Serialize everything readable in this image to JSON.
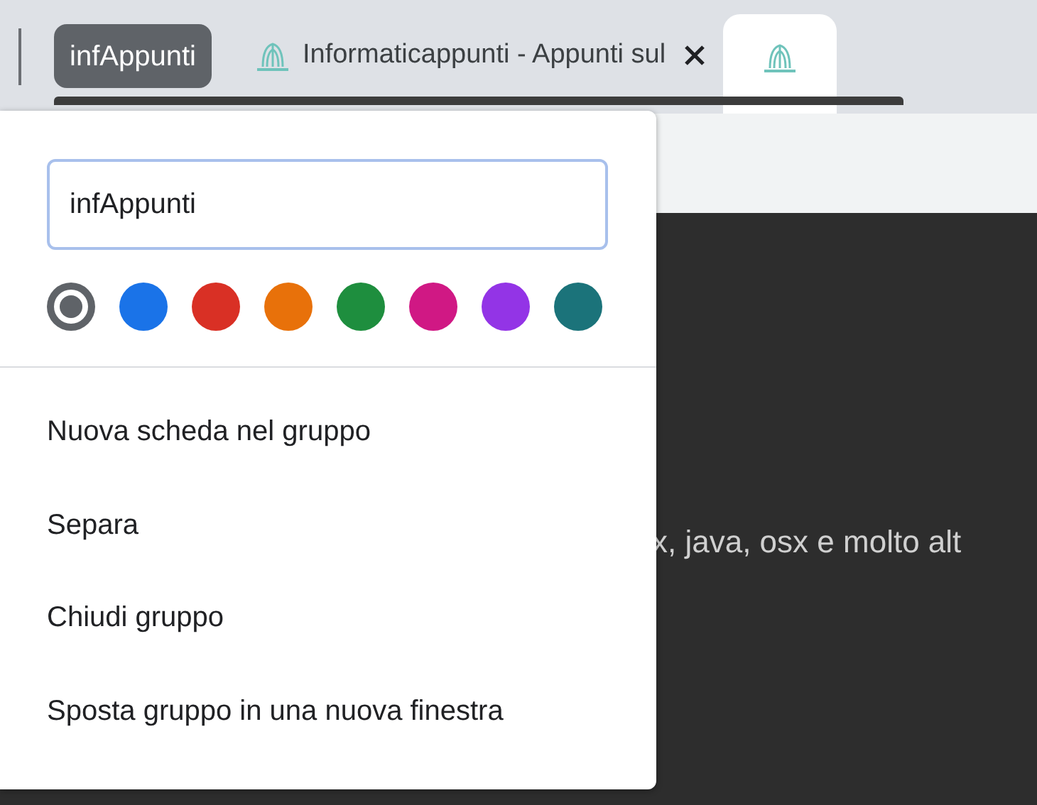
{
  "tab_group": {
    "label": "infAppunti",
    "color": "#5f6368"
  },
  "tabs": [
    {
      "title": "Informaticappunti - Appunti sul",
      "selected": false
    },
    {
      "selected": true
    }
  ],
  "page_text": "x, java, osx e molto alt",
  "group_editor": {
    "name_value": "infAppunti",
    "colors": [
      {
        "color": "#5f6368",
        "selected": true
      },
      {
        "color": "#1a73e8",
        "selected": false
      },
      {
        "color": "#d93025",
        "selected": false
      },
      {
        "color": "#e8710a",
        "selected": false
      },
      {
        "color": "#1e8e3e",
        "selected": false
      },
      {
        "color": "#d01884",
        "selected": false
      },
      {
        "color": "#9334e6",
        "selected": false
      },
      {
        "color": "#1b737a",
        "selected": false
      }
    ],
    "menu": [
      "Nuova scheda nel gruppo",
      "Separa",
      "Chiudi gruppo",
      "Sposta gruppo in una nuova finestra"
    ]
  }
}
